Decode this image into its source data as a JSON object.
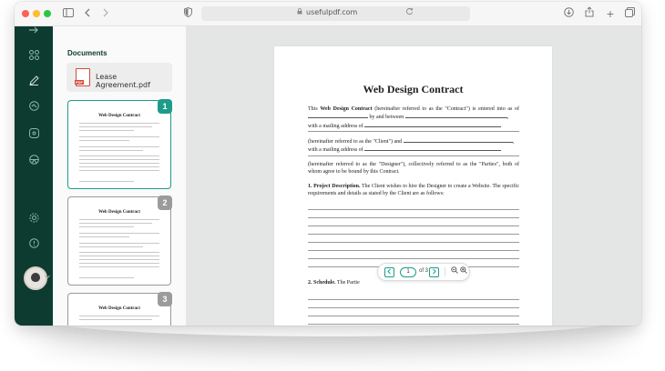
{
  "browser": {
    "url": "usefulpdf.com",
    "lock_icon": "lock-icon",
    "icons": [
      "sidebar-icon",
      "back-icon",
      "forward-icon",
      "shield-icon",
      "reload-icon",
      "download-icon",
      "share-icon",
      "new-tab-icon",
      "tabs-icon"
    ]
  },
  "rail": {
    "icons": [
      "exit-icon",
      "grid-icon",
      "edit-icon",
      "stamp-icon",
      "comment-icon",
      "layers-icon",
      "settings-icon",
      "help-icon"
    ],
    "accent": "#0e3b2f"
  },
  "documents": {
    "heading": "Documents",
    "file_name": "Lease Agreement.pdf",
    "pdf_tag": "PDF",
    "thumbnails": [
      {
        "number": "1",
        "title": "Web Design Contract",
        "active": true
      },
      {
        "number": "2",
        "title": "Web Design Contract",
        "active": false
      },
      {
        "number": "3",
        "title": "Web Design Contract",
        "active": false
      }
    ],
    "accent": "#1e9b8a"
  },
  "document": {
    "title": "Web Design Contract",
    "para1_a": "This ",
    "para1_b": "Web Design Contract",
    "para1_c": " (hereinafter referred to as the \"Contract\") is entered into as of",
    "para1_d": "by and between",
    "para1_e": "with a mailing address of",
    "para2_a": "(hereinafter referred to as the \"Client\") and",
    "para2_b": "with a mailing address of",
    "para3": "(hereinafter referred to as the \"Designer\"), collectively referred to as the \"Parties\", both of whom agree to be bound by this Contract.",
    "section1_heading": "1. Project Description.",
    "section1_text": " The Client wishes to hire the Designer to create a Website. The specific requirements and details as stated by the Client are as follows:",
    "section2_heading": "2. Schedule.",
    "section2_text": " The Partie"
  },
  "navigator": {
    "current_page": "1",
    "of_label": "of 3",
    "zoom_out_icon": "zoom-out-icon",
    "zoom_in_icon": "zoom-in-icon"
  }
}
